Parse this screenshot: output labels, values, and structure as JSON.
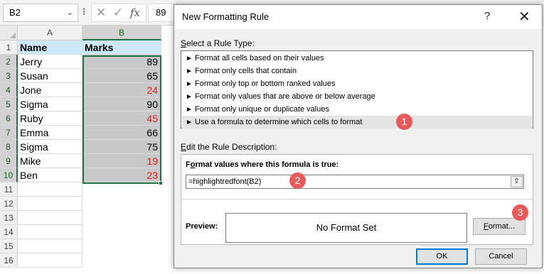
{
  "formula_bar": {
    "name_box": "B2",
    "name_box_chevron": "chevron-down-icon",
    "separator": "⁝",
    "cancel_icon": "✕",
    "enter_icon": "✓",
    "fx_icon": "fx",
    "value": "89"
  },
  "sheet": {
    "columns": [
      "A",
      "B"
    ],
    "row_numbers": [
      "1",
      "2",
      "3",
      "4",
      "5",
      "6",
      "7",
      "8",
      "9",
      "10",
      "11",
      "12",
      "13",
      "14",
      "15",
      "16"
    ],
    "headers": {
      "name": "Name",
      "marks": "Marks"
    },
    "rows": [
      {
        "name": "Jerry",
        "marks": "89",
        "red": false
      },
      {
        "name": "Susan",
        "marks": "65",
        "red": false
      },
      {
        "name": "Jone",
        "marks": "24",
        "red": true
      },
      {
        "name": "Sigma",
        "marks": "90",
        "red": false
      },
      {
        "name": "Ruby",
        "marks": "45",
        "red": true
      },
      {
        "name": "Emma",
        "marks": "66",
        "red": false
      },
      {
        "name": "Sigma",
        "marks": "75",
        "red": false
      },
      {
        "name": "Mike",
        "marks": "19",
        "red": true
      },
      {
        "name": "Ben",
        "marks": "23",
        "red": true
      }
    ],
    "colors": {
      "header_fill": "#cde8f7",
      "marks_fill": "#c8c8c8",
      "red_font": "#e02020",
      "selection": "#217346"
    }
  },
  "dialog": {
    "title": "New Formatting Rule",
    "help": "?",
    "close": "✕",
    "select_rule_type": {
      "first": "S",
      "rest": "elect a Rule Type:"
    },
    "rule_types": [
      "Format all cells based on their values",
      "Format only cells that contain",
      "Format only top or bottom ranked values",
      "Format only values that are above or below average",
      "Format only unique or duplicate values",
      "Use a formula to determine which cells to format"
    ],
    "rule_arrow": "►",
    "edit_desc": {
      "first": "E",
      "rest": "dit the Rule Description:"
    },
    "formula_label": {
      "before": "F",
      "first": "o",
      "rest": "rmat values where this formula is true:"
    },
    "formula_value": "=highlightredfont(B2)",
    "collapse_icon": "⇧",
    "preview_label": "Preview:",
    "preview_text": "No Format Set",
    "format_button": {
      "first": "F",
      "rest": "ormat..."
    },
    "ok": "OK",
    "cancel": "Cancel"
  },
  "badges": [
    "1",
    "2",
    "3"
  ],
  "badge_color": "#e85a5a"
}
